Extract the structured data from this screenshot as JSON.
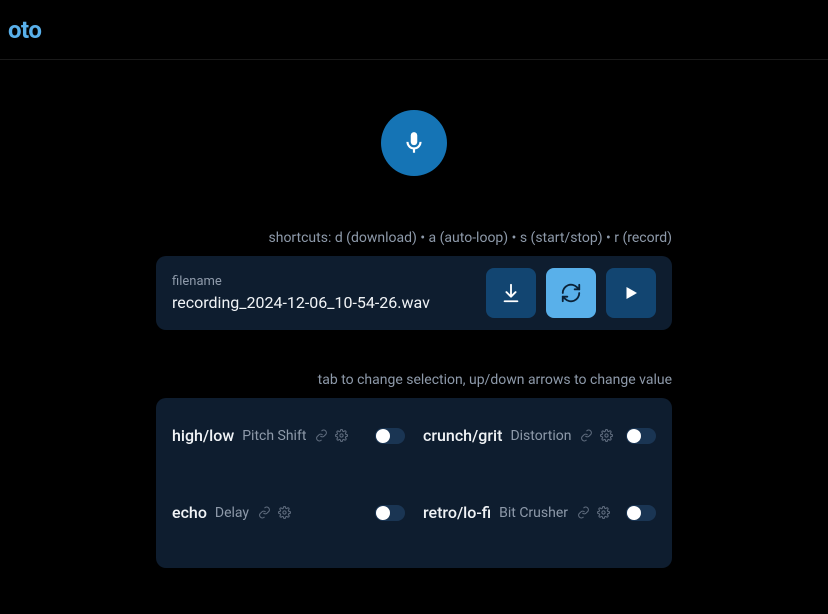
{
  "header": {
    "logo": "oto"
  },
  "hints": {
    "shortcuts": "shortcuts: d (download) • a (auto-loop) • s (start/stop) • r (record)",
    "effects": "tab to change selection, up/down arrows to change value"
  },
  "file": {
    "label": "filename",
    "name": "recording_2024-12-06_10-54-26.wav"
  },
  "effects": [
    {
      "name": "high/low",
      "type": "Pitch Shift",
      "on": false
    },
    {
      "name": "crunch/grit",
      "type": "Distortion",
      "on": false
    },
    {
      "name": "echo",
      "type": "Delay",
      "on": false
    },
    {
      "name": "retro/lo-fi",
      "type": "Bit Crusher",
      "on": false
    }
  ]
}
